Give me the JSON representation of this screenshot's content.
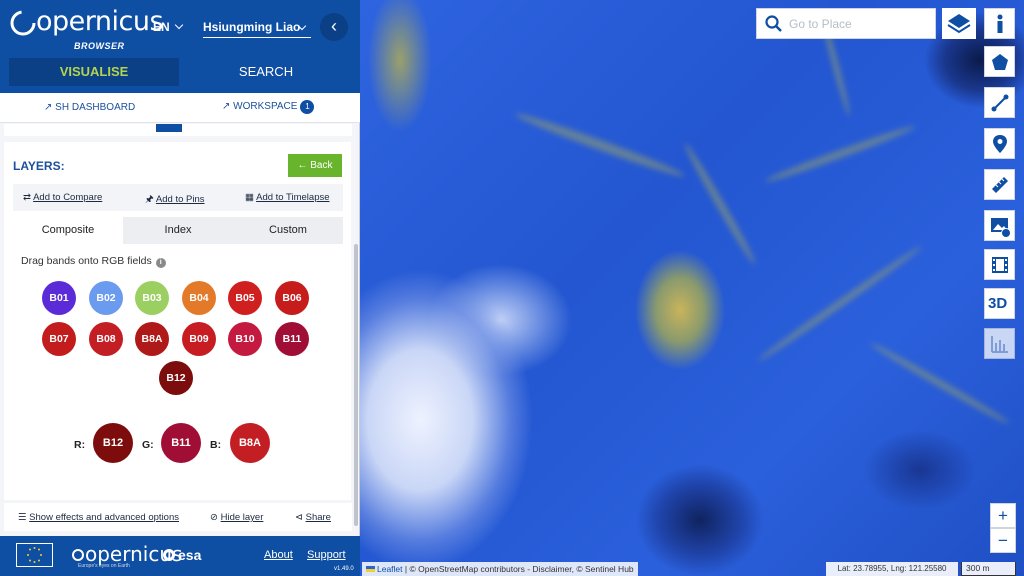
{
  "header": {
    "logo_text": "opernicus",
    "logo_sub": "BROWSER",
    "language": "EN",
    "user": "Hsiungming Liao",
    "tab_visualise": "VISUALISE",
    "tab_search": "SEARCH"
  },
  "links": {
    "dashboard": "SH DASHBOARD",
    "workspace": "WORKSPACE",
    "workspace_count": "1"
  },
  "layers": {
    "title": "LAYERS:",
    "back": "Back",
    "actions": [
      "Add to Compare",
      "Add to Pins",
      "Add to Timelapse"
    ],
    "tabs": [
      "Composite",
      "Index",
      "Custom"
    ],
    "drag_hint": "Drag bands onto RGB fields",
    "info_glyph": "i",
    "bands": [
      {
        "label": "B01",
        "color": "#5b2bd8"
      },
      {
        "label": "B02",
        "color": "#6a9bef"
      },
      {
        "label": "B03",
        "color": "#9ccf62"
      },
      {
        "label": "B04",
        "color": "#e37a2a"
      },
      {
        "label": "B05",
        "color": "#d01f1f"
      },
      {
        "label": "B06",
        "color": "#c71c1c"
      },
      {
        "label": "B07",
        "color": "#c21c1c"
      },
      {
        "label": "B08",
        "color": "#c41e25"
      },
      {
        "label": "B8A",
        "color": "#b01919"
      },
      {
        "label": "B09",
        "color": "#c61c22"
      },
      {
        "label": "B10",
        "color": "#c41a40"
      },
      {
        "label": "B11",
        "color": "#a10e35"
      },
      {
        "label": "B12",
        "color": "#7d0c0c"
      }
    ],
    "rgb": {
      "r_label": "R:",
      "r_band": "B12",
      "r_color": "#7d0c0c",
      "g_label": "G:",
      "g_band": "B11",
      "g_color": "#a10e35",
      "b_label": "B:",
      "b_band": "B8A",
      "b_color": "#c41e25"
    },
    "options": [
      "Show effects and advanced options",
      "Hide layer",
      "Share"
    ]
  },
  "footer": {
    "copernicus": "opernicus",
    "tagline": "Europe's eyes on Earth",
    "esa": "esa",
    "about": "About",
    "support": "Support",
    "version": "v1.49.0"
  },
  "map": {
    "search_placeholder": "Go to Place",
    "threed": "3D",
    "zoom_in": "+",
    "zoom_out": "−",
    "attribution_leaflet": "Leaflet",
    "attribution_rest": "| © OpenStreetMap contributors - Disclaimer, © Sentinel Hub",
    "coords": "Lat: 23.78955, Lng: 121.25580",
    "scale": "300 m"
  }
}
